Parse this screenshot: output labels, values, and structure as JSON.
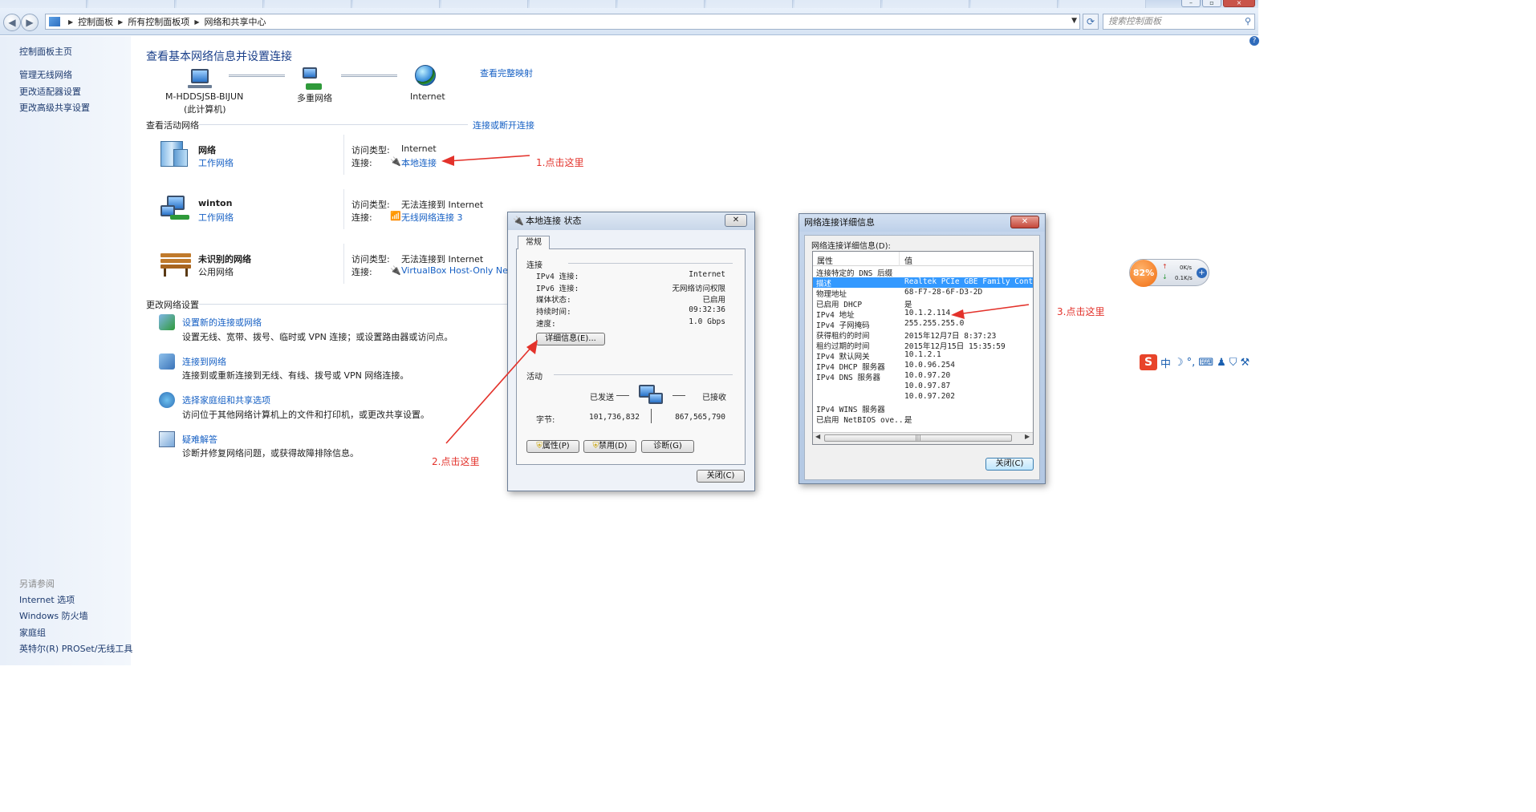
{
  "address_bar": {
    "breadcrumb": [
      "控制面板",
      "所有控制面板项",
      "网络和共享中心"
    ],
    "search_placeholder": "搜索控制面板"
  },
  "sidebar": {
    "items": [
      {
        "label": "控制面板主页"
      },
      {
        "label": "管理无线网络"
      },
      {
        "label": "更改适配器设置"
      },
      {
        "label": "更改高级共享设置"
      }
    ],
    "see_also_title": "另请参阅",
    "see_also": [
      "Internet 选项",
      "Windows 防火墙",
      "家庭组",
      "英特尔(R) PROSet/无线工具"
    ]
  },
  "main": {
    "title": "查看基本网络信息并设置连接",
    "map": {
      "computer_name": "M-HDDSJSB-BIJUN",
      "computer_sub": "(此计算机)",
      "middle": "多重网络",
      "internet": "Internet",
      "full_map_link": "查看完整映射"
    },
    "active_title": "查看活动网络",
    "connect_link": "连接或断开连接",
    "access_label": "访问类型:",
    "conn_label": "连接:",
    "networks": [
      {
        "name": "网络",
        "type": "工作网络",
        "access": "Internet",
        "connection": "本地连接"
      },
      {
        "name": "winton",
        "type": "工作网络",
        "access": "无法连接到 Internet",
        "connection": "无线网络连接 3"
      },
      {
        "name": "未识别的网络",
        "type": "公用网络",
        "access": "无法连接到 Internet",
        "connection": "VirtualBox Host-Only Netwo"
      }
    ],
    "change_title": "更改网络设置",
    "tasks": [
      {
        "title": "设置新的连接或网络",
        "desc": "设置无线、宽带、拨号、临时或 VPN 连接；或设置路由器或访问点。"
      },
      {
        "title": "连接到网络",
        "desc": "连接到或重新连接到无线、有线、拨号或 VPN 网络连接。"
      },
      {
        "title": "选择家庭组和共享选项",
        "desc": "访问位于其他网络计算机上的文件和打印机，或更改共享设置。"
      },
      {
        "title": "疑难解答",
        "desc": "诊断并修复网络问题，或获得故障排除信息。"
      }
    ]
  },
  "status_dialog": {
    "title": "本地连接 状态",
    "close_x": "✕",
    "tab": "常规",
    "section_connection": "连接",
    "rows": [
      {
        "label": "IPv4 连接:",
        "value": "Internet"
      },
      {
        "label": "IPv6 连接:",
        "value": "无网络访问权限"
      },
      {
        "label": "媒体状态:",
        "value": "已启用"
      },
      {
        "label": "持续时间:",
        "value": "09:32:36"
      },
      {
        "label": "速度:",
        "value": "1.0 Gbps"
      }
    ],
    "details_button": "详细信息(E)...",
    "section_activity": "活动",
    "sent_label": "已发送",
    "recv_label": "已接收",
    "bytes_label": "字节:",
    "bytes_sent": "101,736,832",
    "bytes_recv": "867,565,790",
    "properties_button": "属性(P)",
    "disable_button": "禁用(D)",
    "diagnose_button": "诊断(G)",
    "close_button": "关闭(C)"
  },
  "details_dialog": {
    "title": "网络连接详细信息",
    "close_x": "✕",
    "caption": "网络连接详细信息(D):",
    "col_property": "属性",
    "col_value": "值",
    "rows": [
      {
        "property": "连接特定的 DNS 后缀",
        "value": ""
      },
      {
        "property": "描述",
        "value": "Realtek PCIe GBE Family Controlle"
      },
      {
        "property": "物理地址",
        "value": "68-F7-28-6F-D3-2D"
      },
      {
        "property": "已启用 DHCP",
        "value": "是"
      },
      {
        "property": "IPv4 地址",
        "value": "10.1.2.114"
      },
      {
        "property": "IPv4 子网掩码",
        "value": "255.255.255.0"
      },
      {
        "property": "获得租约的时间",
        "value": "2015年12月7日 8:37:23"
      },
      {
        "property": "租约过期的时间",
        "value": "2015年12月15日 15:35:59"
      },
      {
        "property": "IPv4 默认网关",
        "value": "10.1.2.1"
      },
      {
        "property": "IPv4 DHCP 服务器",
        "value": "10.0.96.254"
      },
      {
        "property": "IPv4 DNS 服务器",
        "value": "10.0.97.20"
      },
      {
        "property": "",
        "value": "10.0.97.87"
      },
      {
        "property": "",
        "value": "10.0.97.202"
      },
      {
        "property": "IPv4 WINS 服务器",
        "value": ""
      },
      {
        "property": "已启用 NetBIOS ove...",
        "value": "是"
      }
    ],
    "close_button": "关闭(C)"
  },
  "annotations": [
    "1.点击这里",
    "2.点击这里",
    "3.点击这里"
  ],
  "widget": {
    "percent": "82%",
    "up": "0K/s",
    "down": "0.1K/s"
  },
  "ime_bar": {
    "lang": "中"
  },
  "colors": {
    "link": "#1660c4",
    "annotation": "#e3322b",
    "selection": "#3399ff"
  }
}
